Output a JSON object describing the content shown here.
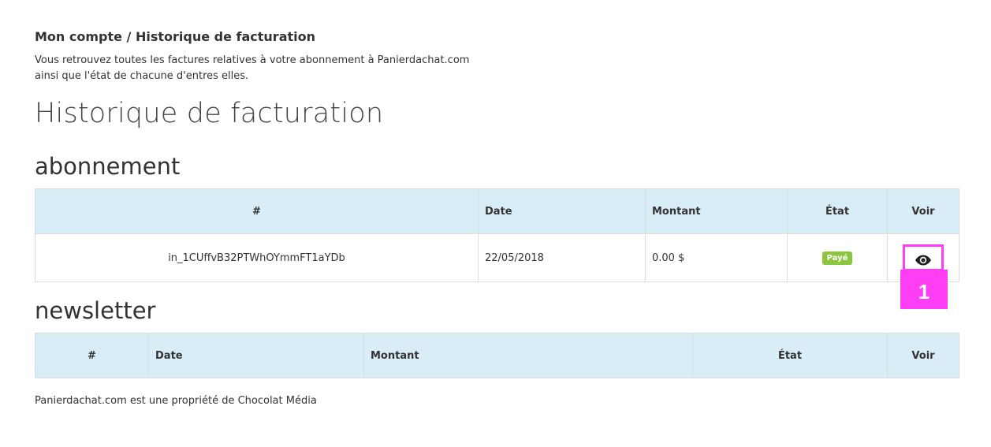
{
  "header": {
    "breadcrumb": "Mon compte / Historique de facturation",
    "intro_line1": "Vous retrouvez toutes les factures relatives à votre abonnement à Panierdachat.com",
    "intro_line2": "ainsi que l'état de chacune d'entres elles."
  },
  "page": {
    "title": "Historique de facturation"
  },
  "abonnement": {
    "title": "abonnement",
    "columns": [
      "#",
      "Date",
      "Montant",
      "État",
      "Voir"
    ],
    "rows": [
      {
        "id": "in_1CUffvB32PTWhOYmmFT1aYDb",
        "date": "22/05/2018",
        "amount": "0.00 $",
        "status": "Payé",
        "view_icon": "eye-icon"
      }
    ]
  },
  "newsletter": {
    "title": "newsletter",
    "columns": [
      "#",
      "Date",
      "Montant",
      "État",
      "Voir"
    ]
  },
  "annotation": {
    "label": "1"
  },
  "footer": {
    "text": "Panierdachat.com est une propriété de Chocolat Média"
  },
  "colors": {
    "header_bg": "#d9edf7",
    "badge_green": "#8cc63f",
    "highlight": "#ff3df5"
  }
}
